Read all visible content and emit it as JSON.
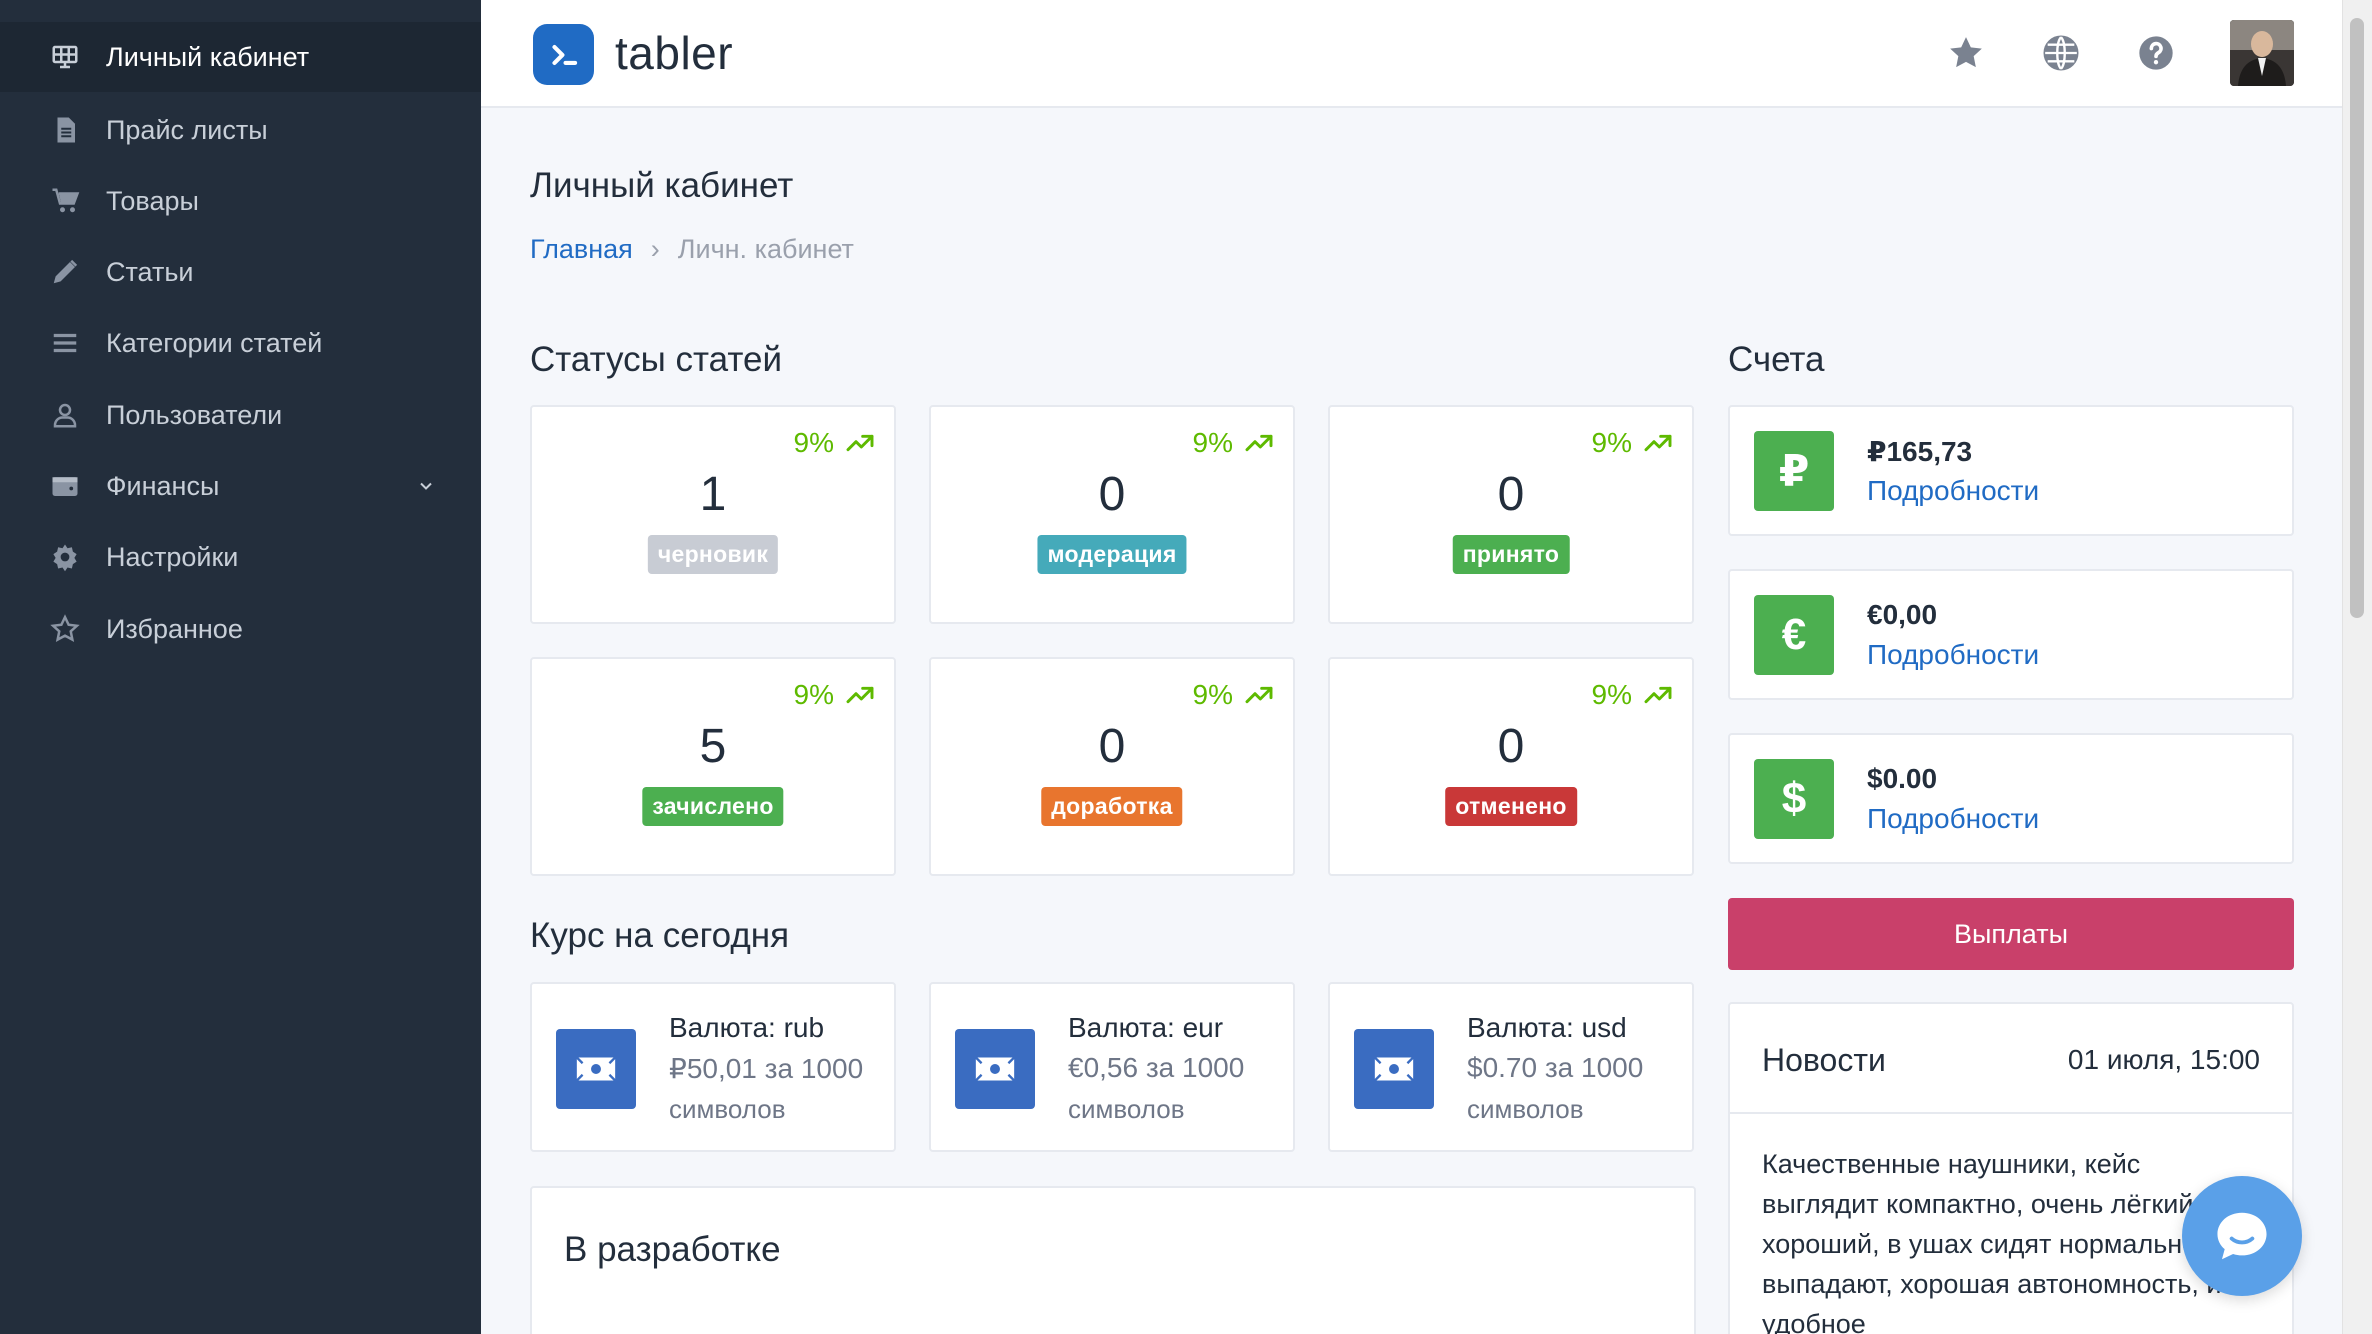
{
  "sidebar": {
    "items": [
      {
        "label": "Личный кабинет",
        "icon": "dashboard-icon"
      },
      {
        "label": "Прайс листы",
        "icon": "file-icon"
      },
      {
        "label": "Товары",
        "icon": "cart-icon"
      },
      {
        "label": "Статьи",
        "icon": "pencil-icon"
      },
      {
        "label": "Категории статей",
        "icon": "list-icon"
      },
      {
        "label": "Пользователи",
        "icon": "user-icon"
      },
      {
        "label": "Финансы",
        "icon": "wallet-icon"
      },
      {
        "label": "Настройки",
        "icon": "gear-icon"
      },
      {
        "label": "Избранное",
        "icon": "star-icon"
      }
    ]
  },
  "header": {
    "logo_text": "tabler"
  },
  "page": {
    "title": "Личный кабинет",
    "breadcrumb": {
      "home": "Главная",
      "sep": "›",
      "current": "Личн. кабинет"
    }
  },
  "statuses": {
    "title": "Статусы статей",
    "cards": [
      {
        "trend": "9%",
        "value": "1",
        "label": "черновик",
        "color": "#c8ccd4"
      },
      {
        "trend": "9%",
        "value": "0",
        "label": "модерация",
        "color": "#45aaba"
      },
      {
        "trend": "9%",
        "value": "0",
        "label": "принято",
        "color": "#4caf50"
      },
      {
        "trend": "9%",
        "value": "5",
        "label": "зачислено",
        "color": "#4caf50"
      },
      {
        "trend": "9%",
        "value": "0",
        "label": "доработка",
        "color": "#e8752e"
      },
      {
        "trend": "9%",
        "value": "0",
        "label": "отменено",
        "color": "#c93838"
      }
    ]
  },
  "rates": {
    "title": "Курс на сегодня",
    "cards": [
      {
        "title": "Валюта: rub",
        "price": "₽50,01 за 1000",
        "unit": "символов"
      },
      {
        "title": "Валюта: eur",
        "price": "€0,56 за 1000",
        "unit": "символов"
      },
      {
        "title": "Валюта: usd",
        "price": "$0.70 за 1000",
        "unit": "символов"
      }
    ]
  },
  "accounts": {
    "title": "Счета",
    "items": [
      {
        "symbol": "₽",
        "amount": "₽165,73",
        "link": "Подробности"
      },
      {
        "symbol": "€",
        "amount": "€0,00",
        "link": "Подробности"
      },
      {
        "symbol": "$",
        "amount": "$0.00",
        "link": "Подробности"
      }
    ],
    "payout_label": "Выплаты"
  },
  "news": {
    "title": "Новости",
    "date": "01 июля, 15:00",
    "body": "Качественные наушники, кейс выглядит компактно, очень лёгкий, звук хороший, в ушах сидят нормально, не выпадают, хорошая автономность, и удобное"
  },
  "dev": {
    "title": "В разработке"
  }
}
